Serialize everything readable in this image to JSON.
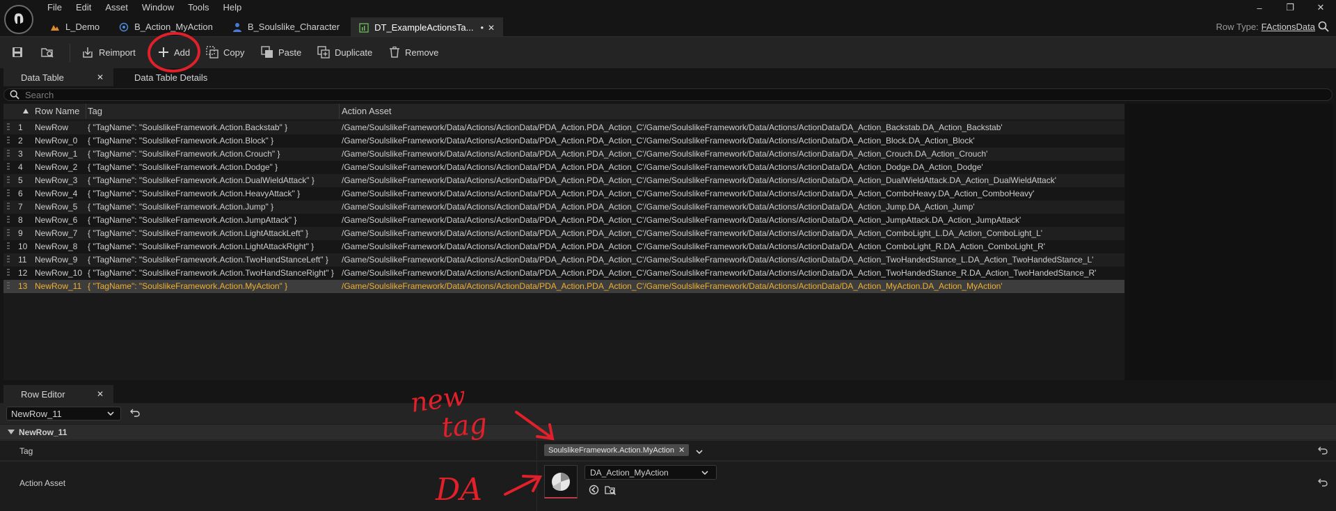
{
  "menu": [
    "File",
    "Edit",
    "Asset",
    "Window",
    "Tools",
    "Help"
  ],
  "tabs": [
    {
      "label": "L_Demo",
      "icon": "level-icon"
    },
    {
      "label": "B_Action_MyAction",
      "icon": "blueprint-icon"
    },
    {
      "label": "B_Soulslike_Character",
      "icon": "character-icon"
    },
    {
      "label": "DT_ExampleActionsTa...",
      "icon": "datatable-icon",
      "active": true,
      "modified_marker": "•",
      "close": "✕"
    }
  ],
  "row_type": {
    "label": "Row Type:",
    "value": "FActionsData"
  },
  "toolbar": {
    "reimport": "Reimport",
    "add": "Add",
    "copy": "Copy",
    "paste": "Paste",
    "duplicate": "Duplicate",
    "remove": "Remove"
  },
  "panel_tabs": {
    "data_table": "Data Table",
    "details": "Data Table Details",
    "close": "✕"
  },
  "search": {
    "placeholder": "Search"
  },
  "table": {
    "headers": {
      "row_name": "Row Name",
      "tag": "Tag",
      "action_asset": "Action Asset"
    },
    "rows": [
      {
        "num": "1",
        "name": "NewRow",
        "tag": "{ \"TagName\": \"SoulslikeFramework.Action.Backstab\" }",
        "asset": "/Game/SoulslikeFramework/Data/Actions/ActionData/PDA_Action.PDA_Action_C'/Game/SoulslikeFramework/Data/Actions/ActionData/DA_Action_Backstab.DA_Action_Backstab'"
      },
      {
        "num": "2",
        "name": "NewRow_0",
        "tag": "{ \"TagName\": \"SoulslikeFramework.Action.Block\" }",
        "asset": "/Game/SoulslikeFramework/Data/Actions/ActionData/PDA_Action.PDA_Action_C'/Game/SoulslikeFramework/Data/Actions/ActionData/DA_Action_Block.DA_Action_Block'"
      },
      {
        "num": "3",
        "name": "NewRow_1",
        "tag": "{ \"TagName\": \"SoulslikeFramework.Action.Crouch\" }",
        "asset": "/Game/SoulslikeFramework/Data/Actions/ActionData/PDA_Action.PDA_Action_C'/Game/SoulslikeFramework/Data/Actions/ActionData/DA_Action_Crouch.DA_Action_Crouch'"
      },
      {
        "num": "4",
        "name": "NewRow_2",
        "tag": "{ \"TagName\": \"SoulslikeFramework.Action.Dodge\" }",
        "asset": "/Game/SoulslikeFramework/Data/Actions/ActionData/PDA_Action.PDA_Action_C'/Game/SoulslikeFramework/Data/Actions/ActionData/DA_Action_Dodge.DA_Action_Dodge'"
      },
      {
        "num": "5",
        "name": "NewRow_3",
        "tag": "{ \"TagName\": \"SoulslikeFramework.Action.DualWieldAttack\" }",
        "asset": "/Game/SoulslikeFramework/Data/Actions/ActionData/PDA_Action.PDA_Action_C'/Game/SoulslikeFramework/Data/Actions/ActionData/DA_Action_DualWieldAttack.DA_Action_DualWieldAttack'"
      },
      {
        "num": "6",
        "name": "NewRow_4",
        "tag": "{ \"TagName\": \"SoulslikeFramework.Action.HeavyAttack\" }",
        "asset": "/Game/SoulslikeFramework/Data/Actions/ActionData/PDA_Action.PDA_Action_C'/Game/SoulslikeFramework/Data/Actions/ActionData/DA_Action_ComboHeavy.DA_Action_ComboHeavy'"
      },
      {
        "num": "7",
        "name": "NewRow_5",
        "tag": "{ \"TagName\": \"SoulslikeFramework.Action.Jump\" }",
        "asset": "/Game/SoulslikeFramework/Data/Actions/ActionData/PDA_Action.PDA_Action_C'/Game/SoulslikeFramework/Data/Actions/ActionData/DA_Action_Jump.DA_Action_Jump'"
      },
      {
        "num": "8",
        "name": "NewRow_6",
        "tag": "{ \"TagName\": \"SoulslikeFramework.Action.JumpAttack\" }",
        "asset": "/Game/SoulslikeFramework/Data/Actions/ActionData/PDA_Action.PDA_Action_C'/Game/SoulslikeFramework/Data/Actions/ActionData/DA_Action_JumpAttack.DA_Action_JumpAttack'"
      },
      {
        "num": "9",
        "name": "NewRow_7",
        "tag": "{ \"TagName\": \"SoulslikeFramework.Action.LightAttackLeft\" }",
        "asset": "/Game/SoulslikeFramework/Data/Actions/ActionData/PDA_Action.PDA_Action_C'/Game/SoulslikeFramework/Data/Actions/ActionData/DA_Action_ComboLight_L.DA_Action_ComboLight_L'"
      },
      {
        "num": "10",
        "name": "NewRow_8",
        "tag": "{ \"TagName\": \"SoulslikeFramework.Action.LightAttackRight\" }",
        "asset": "/Game/SoulslikeFramework/Data/Actions/ActionData/PDA_Action.PDA_Action_C'/Game/SoulslikeFramework/Data/Actions/ActionData/DA_Action_ComboLight_R.DA_Action_ComboLight_R'"
      },
      {
        "num": "11",
        "name": "NewRow_9",
        "tag": "{ \"TagName\": \"SoulslikeFramework.Action.TwoHandStanceLeft\" }",
        "asset": "/Game/SoulslikeFramework/Data/Actions/ActionData/PDA_Action.PDA_Action_C'/Game/SoulslikeFramework/Data/Actions/ActionData/DA_Action_TwoHandedStance_L.DA_Action_TwoHandedStance_L'"
      },
      {
        "num": "12",
        "name": "NewRow_10",
        "tag": "{ \"TagName\": \"SoulslikeFramework.Action.TwoHandStanceRight\" }",
        "asset": "/Game/SoulslikeFramework/Data/Actions/ActionData/PDA_Action.PDA_Action_C'/Game/SoulslikeFramework/Data/Actions/ActionData/DA_Action_TwoHandedStance_R.DA_Action_TwoHandedStance_R'"
      },
      {
        "num": "13",
        "name": "NewRow_11",
        "tag": "{ \"TagName\": \"SoulslikeFramework.Action.MyAction\" }",
        "asset": "/Game/SoulslikeFramework/Data/Actions/ActionData/PDA_Action.PDA_Action_C'/Game/SoulslikeFramework/Data/Actions/ActionData/DA_Action_MyAction.DA_Action_MyAction'",
        "selected": true
      }
    ]
  },
  "row_editor": {
    "tab_label": "Row Editor",
    "close": "✕",
    "selected_row": "NewRow_11",
    "section": "NewRow_11",
    "tag_label": "Tag",
    "tag_value": "SoulslikeFramework.Action.MyAction",
    "action_asset_label": "Action Asset",
    "action_asset_value": "DA_Action_MyAction"
  },
  "annotations": {
    "new_tag_line1": "new",
    "new_tag_line2": "tag",
    "da": "DA",
    "color": "#e0202a"
  },
  "colors": {
    "selected_row_text": "#f0b030",
    "asset_thumb_accent": "#c0394a"
  }
}
